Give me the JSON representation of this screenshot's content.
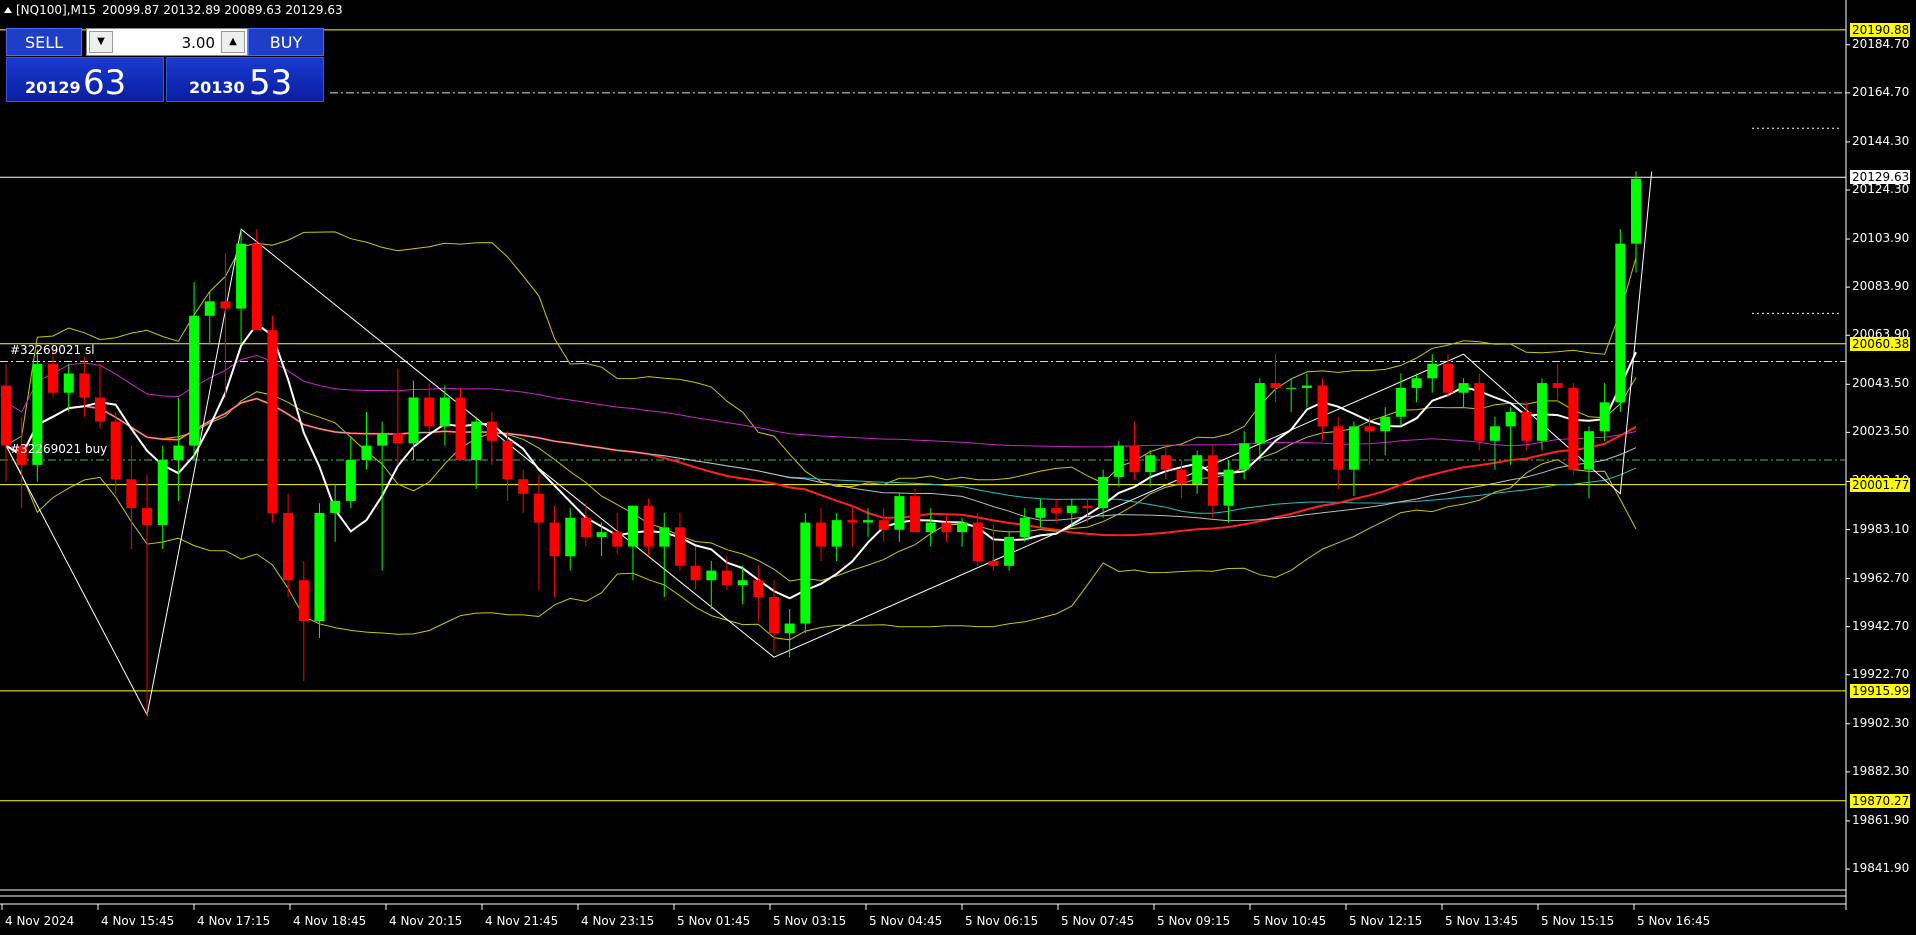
{
  "header": {
    "symbol_timeframe": "[NQ100],M15",
    "ohlc": "20099.87 20132.89 20089.63 20129.63"
  },
  "trade_panel": {
    "sell_label": "SELL",
    "buy_label": "BUY",
    "lot_value": "3.00",
    "sell_price_main": "20129",
    "sell_price_big": "63",
    "buy_price_main": "20130",
    "buy_price_big": "53"
  },
  "price_axis": {
    "ticks": [
      "20184.70",
      "20164.70",
      "20144.30",
      "20124.30",
      "20103.90",
      "20083.90",
      "20063.90",
      "20043.50",
      "20023.50",
      "20003.10",
      "19983.10",
      "19962.70",
      "19942.70",
      "19922.70",
      "19902.30",
      "19882.30",
      "19861.90",
      "19841.90"
    ],
    "tick_values": [
      20184.7,
      20164.7,
      20144.3,
      20124.3,
      20103.9,
      20083.9,
      20063.9,
      20043.5,
      20023.5,
      20003.1,
      19983.1,
      19962.7,
      19942.7,
      19922.7,
      19902.3,
      19882.3,
      19861.9,
      19841.9
    ],
    "range": [
      19834.0,
      20200.0
    ]
  },
  "level_tags": [
    {
      "label": "20190.88",
      "value": 20190.88,
      "style": "yellow"
    },
    {
      "label": "20129.63",
      "value": 20129.63,
      "style": "white"
    },
    {
      "label": "20060.38",
      "value": 20060.38,
      "style": "yellow"
    },
    {
      "label": "20001.77",
      "value": 20001.77,
      "style": "yellow"
    },
    {
      "label": "19915.99",
      "value": 19915.99,
      "style": "yellow"
    },
    {
      "label": "19870.27",
      "value": 19870.27,
      "style": "yellow"
    }
  ],
  "orders": [
    {
      "label": "#32269021 sl"
    },
    {
      "label": "#32269021 buy"
    }
  ],
  "time_axis": {
    "labels": [
      "4 Nov 2024",
      "4 Nov 15:45",
      "4 Nov 17:15",
      "4 Nov 18:45",
      "4 Nov 20:15",
      "4 Nov 21:45",
      "4 Nov 23:15",
      "5 Nov 01:45",
      "5 Nov 03:15",
      "5 Nov 04:45",
      "5 Nov 06:15",
      "5 Nov 07:45",
      "5 Nov 09:15",
      "5 Nov 10:45",
      "5 Nov 12:15",
      "5 Nov 13:45",
      "5 Nov 15:15",
      "5 Nov 16:45"
    ]
  },
  "colors": {
    "bull": "#00ff00",
    "bear": "#ff0000",
    "ma_fast": "#ffffff",
    "ma_red": "#ff2020",
    "ma_magenta": "#cc22cc",
    "ma_cyan": "#20c0c0",
    "bands": "#c8c800",
    "levels": "#ffff00"
  },
  "chart_data": {
    "type": "candlestick",
    "symbol": "[NQ100]",
    "timeframe": "M15",
    "candles": [
      [
        20043,
        20052,
        20003,
        20018
      ],
      [
        20018,
        20030,
        19992,
        20010
      ],
      [
        20010,
        20058,
        20003,
        20052
      ],
      [
        20052,
        20060,
        20038,
        20040
      ],
      [
        20040,
        20052,
        20032,
        20048
      ],
      [
        20048,
        20055,
        20030,
        20038
      ],
      [
        20038,
        20052,
        20025,
        20028
      ],
      [
        20028,
        20032,
        19998,
        20004
      ],
      [
        20004,
        20018,
        19975,
        19992
      ],
      [
        19992,
        20006,
        19906,
        19985
      ],
      [
        19985,
        20018,
        19975,
        20012
      ],
      [
        20012,
        20038,
        19995,
        20018
      ],
      [
        20018,
        20086,
        20012,
        20072
      ],
      [
        20072,
        20082,
        20060,
        20078
      ],
      [
        20078,
        20098,
        20038,
        20075
      ],
      [
        20075,
        20108,
        20060,
        20102
      ],
      [
        20102,
        20108,
        20070,
        20066
      ],
      [
        20066,
        20072,
        19986,
        19990
      ],
      [
        19990,
        19998,
        19955,
        19962
      ],
      [
        19962,
        19970,
        19920,
        19945
      ],
      [
        19945,
        19994,
        19938,
        19990
      ],
      [
        19990,
        20002,
        19978,
        19995
      ],
      [
        19995,
        20022,
        19992,
        20012
      ],
      [
        20012,
        20032,
        20008,
        20018
      ],
      [
        20018,
        20028,
        19966,
        20023
      ],
      [
        20023,
        20050,
        20010,
        20019
      ],
      [
        20019,
        20045,
        20012,
        20038
      ],
      [
        20038,
        20044,
        20024,
        20026
      ],
      [
        20026,
        20043,
        20018,
        20038
      ],
      [
        20038,
        20042,
        20013,
        20012
      ],
      [
        20012,
        20030,
        20000,
        20028
      ],
      [
        20028,
        20032,
        20010,
        20020
      ],
      [
        20020,
        20024,
        19995,
        20004
      ],
      [
        20004,
        20008,
        19990,
        19998
      ],
      [
        19998,
        20006,
        19958,
        19986
      ],
      [
        19986,
        19993,
        19955,
        19972
      ],
      [
        19972,
        19992,
        19966,
        19988
      ],
      [
        19988,
        19994,
        19976,
        19980
      ],
      [
        19980,
        19986,
        19972,
        19982
      ],
      [
        19982,
        19990,
        19973,
        19976
      ],
      [
        19976,
        19993,
        19962,
        19993
      ],
      [
        19993,
        19996,
        19972,
        19976
      ],
      [
        19976,
        19990,
        19955,
        19984
      ],
      [
        19984,
        19990,
        19966,
        19968
      ],
      [
        19968,
        19976,
        19958,
        19962
      ],
      [
        19962,
        19970,
        19950,
        19966
      ],
      [
        19966,
        19972,
        19958,
        19960
      ],
      [
        19960,
        19968,
        19952,
        19962
      ],
      [
        19962,
        19968,
        19945,
        19955
      ],
      [
        19955,
        19962,
        19932,
        19940
      ],
      [
        19940,
        19950,
        19930,
        19944
      ],
      [
        19944,
        19990,
        19940,
        19986
      ],
      [
        19986,
        19992,
        19970,
        19976
      ],
      [
        19976,
        19990,
        19970,
        19987
      ],
      [
        19987,
        19993,
        19976,
        19986
      ],
      [
        19986,
        19992,
        19980,
        19987
      ],
      [
        19987,
        19992,
        19978,
        19983
      ],
      [
        19983,
        19998,
        19978,
        19997
      ],
      [
        19997,
        20000,
        19982,
        19982
      ],
      [
        19982,
        19992,
        19976,
        19986
      ],
      [
        19986,
        19990,
        19978,
        19982
      ],
      [
        19982,
        19988,
        19976,
        19986
      ],
      [
        19986,
        19990,
        19968,
        19970
      ],
      [
        19970,
        19985,
        19966,
        19968
      ],
      [
        19968,
        19982,
        19966,
        19980
      ],
      [
        19980,
        19992,
        19978,
        19988
      ],
      [
        19988,
        19996,
        19984,
        19992
      ],
      [
        19992,
        19996,
        19986,
        19990
      ],
      [
        19990,
        19996,
        19984,
        19993
      ],
      [
        19993,
        19996,
        19986,
        19992
      ],
      [
        19992,
        20008,
        19988,
        20005
      ],
      [
        20005,
        20020,
        20001,
        20018
      ],
      [
        20018,
        20028,
        20004,
        20007
      ],
      [
        20007,
        20016,
        20001,
        20014
      ],
      [
        20014,
        20018,
        20004,
        20008
      ],
      [
        20008,
        20012,
        19996,
        20002
      ],
      [
        20002,
        20016,
        19998,
        20014
      ],
      [
        20014,
        20018,
        19988,
        19993
      ],
      [
        19993,
        20012,
        19986,
        20008
      ],
      [
        20008,
        20024,
        20004,
        20019
      ],
      [
        20019,
        20046,
        20014,
        20044
      ],
      [
        20044,
        20056,
        20036,
        20042
      ],
      [
        20042,
        20046,
        20032,
        20042
      ],
      [
        20042,
        20048,
        20034,
        20043
      ],
      [
        20043,
        20046,
        20020,
        20026
      ],
      [
        20026,
        20030,
        20000,
        20008
      ],
      [
        20008,
        20028,
        19997,
        20026
      ],
      [
        20026,
        20030,
        20010,
        20024
      ],
      [
        20024,
        20034,
        20014,
        20030
      ],
      [
        20030,
        20048,
        20026,
        20042
      ],
      [
        20042,
        20048,
        20036,
        20046
      ],
      [
        20046,
        20056,
        20040,
        20052
      ],
      [
        20052,
        20056,
        20038,
        20040
      ],
      [
        20040,
        20046,
        20034,
        20044
      ],
      [
        20044,
        20048,
        20016,
        20020
      ],
      [
        20020,
        20030,
        20008,
        20026
      ],
      [
        20026,
        20034,
        20010,
        20032
      ],
      [
        20032,
        20036,
        20016,
        20020
      ],
      [
        20020,
        20046,
        20016,
        20044
      ],
      [
        20044,
        20052,
        20036,
        20042
      ],
      [
        20042,
        20044,
        20006,
        20008
      ],
      [
        20008,
        20026,
        19996,
        20024
      ],
      [
        20024,
        20044,
        20020,
        20036
      ],
      [
        20036,
        20108,
        20032,
        20102
      ],
      [
        20102,
        20132,
        20090,
        20129
      ]
    ],
    "price_range": [
      19834.0,
      20200.0
    ],
    "horizontal_levels": [
      20190.88,
      20129.63,
      20060.38,
      20001.77,
      19915.99,
      19870.27
    ]
  }
}
